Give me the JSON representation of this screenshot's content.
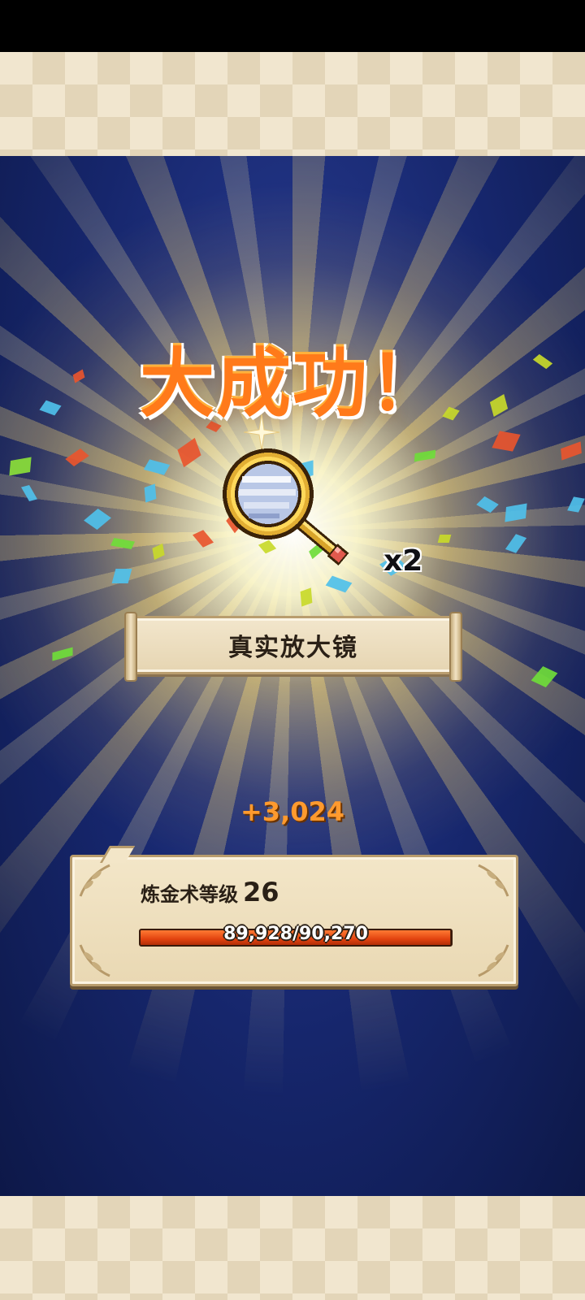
{
  "result": {
    "headline": "大成功！",
    "item_name": "真实放大镜",
    "quantity_label": "x2",
    "item_icon": "magnifying-glass-icon"
  },
  "alchemy": {
    "xp_gain": "+3,024",
    "level_label": "炼金术等级",
    "level": "26",
    "progress_text": "89,928/90,270",
    "progress_fraction": 0.9962
  },
  "colors": {
    "accent_orange": "#ff7a1a",
    "panel_cream": "#f3e6c8",
    "background_blue": "#16266c"
  }
}
